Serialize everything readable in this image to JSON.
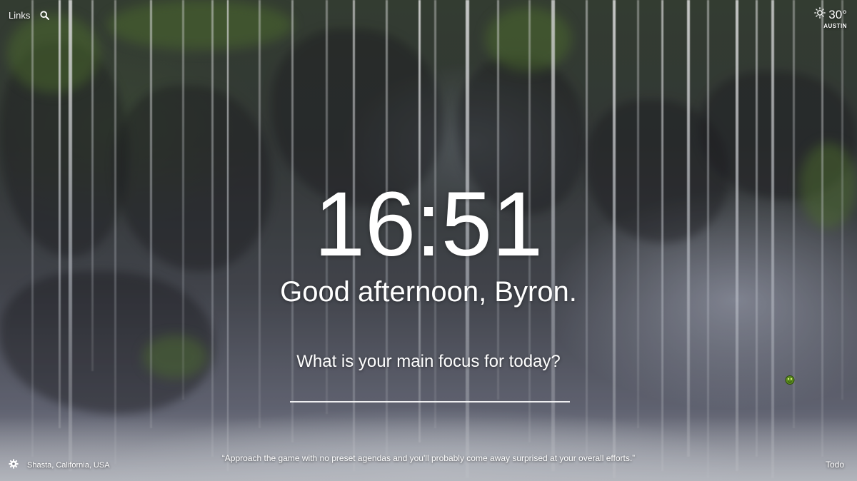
{
  "header": {
    "links_label": "Links",
    "search_icon": "search-icon"
  },
  "weather": {
    "icon": "sun-icon",
    "temperature": "30°",
    "location": "AUSTIN"
  },
  "main": {
    "time": "16:51",
    "greeting": "Good afternoon, Byron.",
    "focus_question": "What is your main focus for today?",
    "focus_value": "",
    "focus_placeholder": ""
  },
  "footer": {
    "settings_icon": "gear-icon",
    "photo_location": "Shasta, California, USA",
    "quote": "“Approach the game with no preset agendas and you'll probably come away surprised at your overall efforts.”",
    "todo_label": "Todo"
  }
}
